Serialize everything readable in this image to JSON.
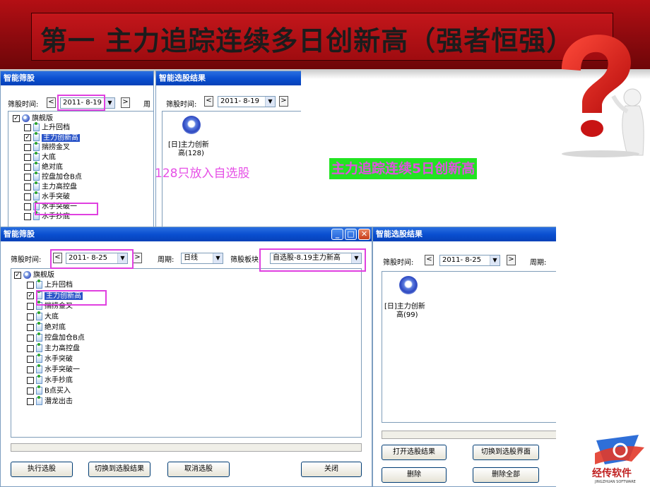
{
  "slide": {
    "title": "第一 主力追踪连续多日创新高（强者恒强）",
    "note_pink": "128只放入自选股",
    "note_green": "主力追踪连续5日创新高",
    "logo_text": "经传软件",
    "logo_sub": "JINGZHUAN SOFTWARE"
  },
  "win1": {
    "title": "智能筛股",
    "date_label": "筛股时间:",
    "date_value": "2011- 8-19",
    "period_label": "周",
    "tree": {
      "root": "旗舰版",
      "items": [
        "上升回档",
        "主力创新高",
        "揣捞金叉",
        "大底",
        "绝对底",
        "控盘加仓B点",
        "主力高控盘",
        "水手突破",
        "水手突破一",
        "水手抄底"
      ]
    }
  },
  "win2": {
    "title": "智能选股结果",
    "date_label": "筛股时间:",
    "date_value": "2011- 8-19",
    "result_line1": "[日]主力创新",
    "result_line2": "高(128)"
  },
  "win3": {
    "title": "智能筛股",
    "date_label": "筛股时间:",
    "date_value": "2011- 8-25",
    "period_label": "周期:",
    "period_value": "日线",
    "board_label": "筛股板块:",
    "board_value": "自选股-8.19主力新高",
    "tree": {
      "root": "旗舰版",
      "items": [
        "上升回档",
        "主力创新高",
        "揣捞金叉",
        "大底",
        "绝对底",
        "控盘加仓B点",
        "主力高控盘",
        "水手突破",
        "水手突破一",
        "水手抄底",
        "B点买入",
        "潜龙出击"
      ]
    },
    "buttons": {
      "run": "执行选股",
      "switch": "切换到选股结果",
      "cancel": "取消选股",
      "close": "关闭"
    }
  },
  "win4": {
    "title": "智能选股结果",
    "date_label": "筛股时间:",
    "date_value": "2011- 8-25",
    "period_label": "周期:",
    "result_line1": "[日]主力创新",
    "result_line2": "高(99)",
    "buttons": {
      "open": "打开选股结果",
      "switch": "切换到选股界面",
      "delete": "删除",
      "delete_all": "删除全部"
    }
  },
  "colors": {
    "banner_red": "#b40f14",
    "highlight_pink": "#e040e0",
    "note_green_bg": "#22e422",
    "xp_title_blue": "#0a4fd0"
  }
}
